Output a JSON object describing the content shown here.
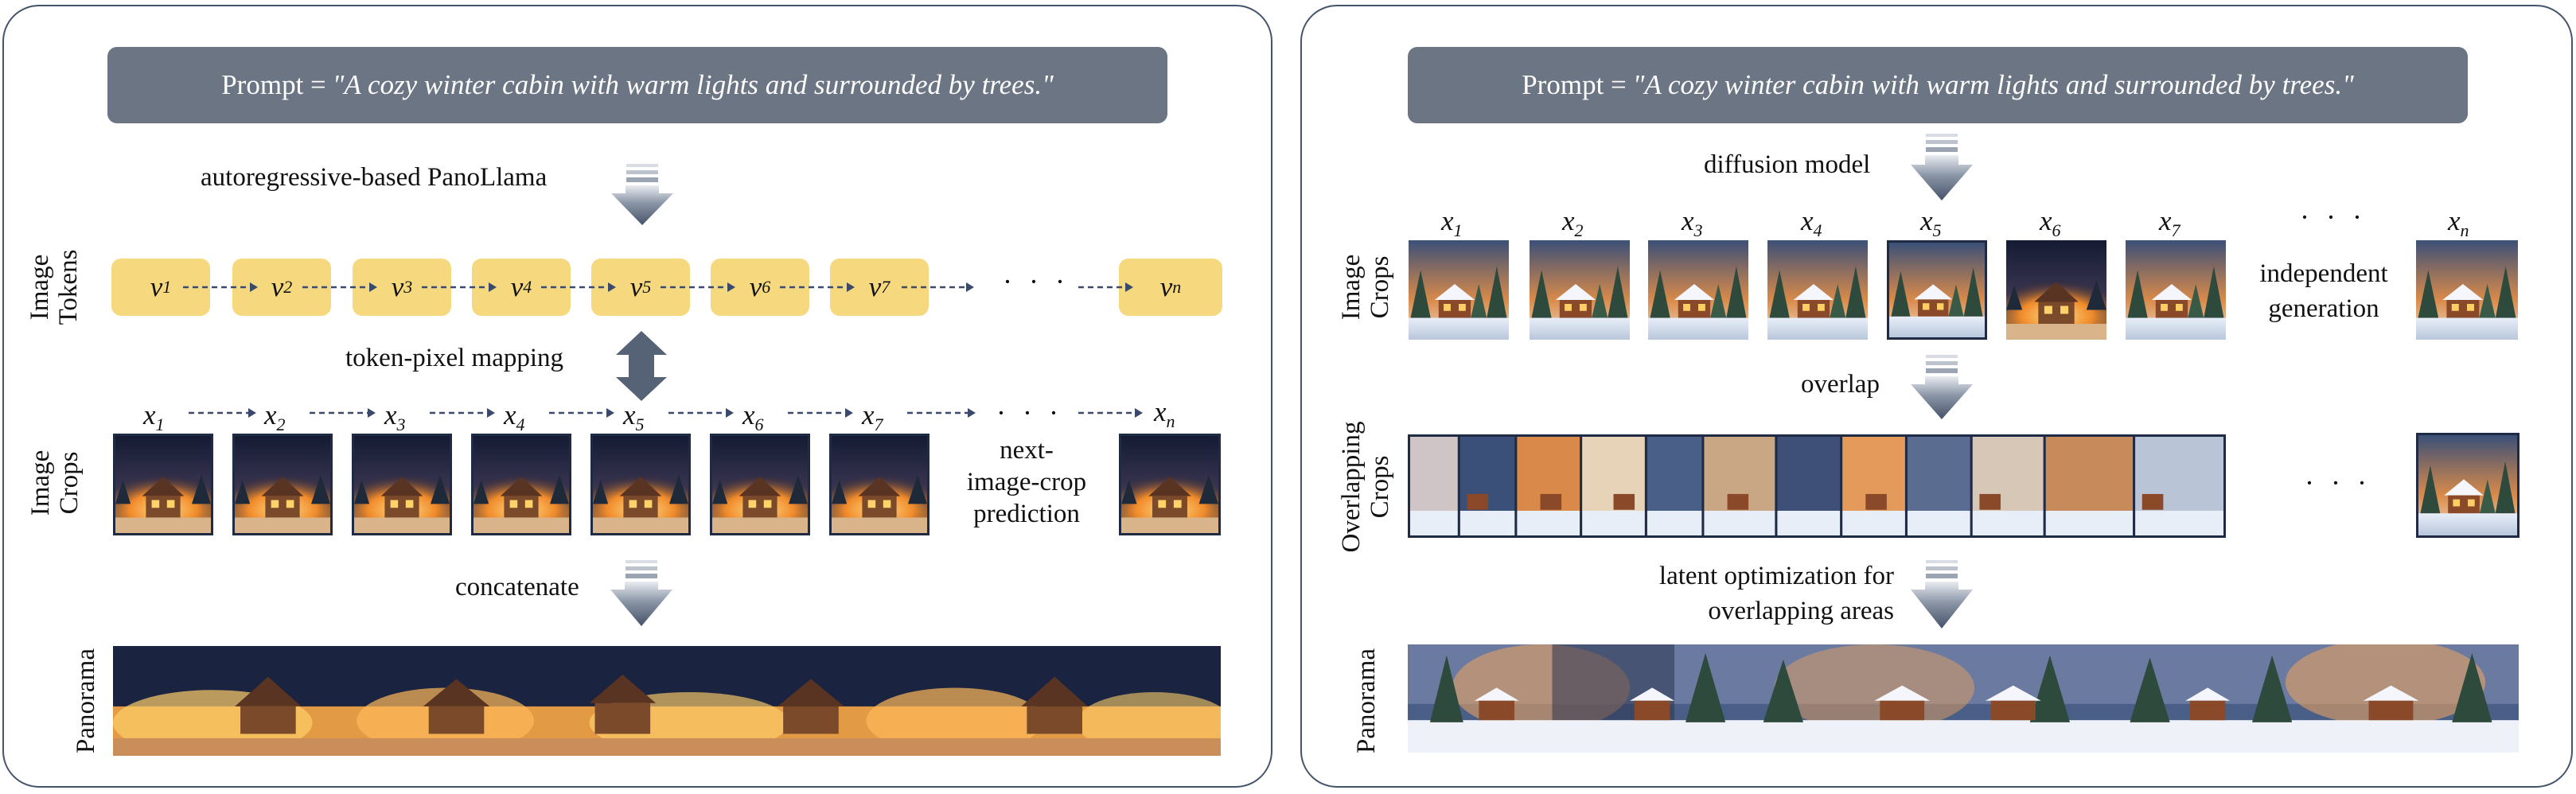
{
  "left": {
    "prompt_label": "Prompt = ",
    "prompt_text": "\"A cozy winter cabin with warm lights and surrounded by trees.\"",
    "step1": "autoregressive-based PanoLlama",
    "row_tokens_label_1": "Image",
    "row_tokens_label_2": "Tokens",
    "tokens": [
      "v",
      "v",
      "v",
      "v",
      "v",
      "v",
      "v",
      "v"
    ],
    "token_subs": [
      "1",
      "2",
      "3",
      "4",
      "5",
      "6",
      "7",
      "n"
    ],
    "step2": "token-pixel mapping",
    "row_crops_label_1": "Image",
    "row_crops_label_2": "Crops",
    "x_symbol": "x",
    "x_subs": [
      "1",
      "2",
      "3",
      "4",
      "5",
      "6",
      "7",
      "n"
    ],
    "ellipsis": "· · ·",
    "note_1": "next-",
    "note_2": "image-crop",
    "note_3": "prediction",
    "step3": "concatenate",
    "row_pano_label": "Panorama"
  },
  "right": {
    "prompt_label": "Prompt = ",
    "prompt_text": "\"A cozy winter cabin with warm lights and surrounded by trees.\"",
    "step1": "diffusion model",
    "row_crops_label_1": "Image",
    "row_crops_label_2": "Crops",
    "x_symbol": "x",
    "x_subs": [
      "1",
      "2",
      "3",
      "4",
      "5",
      "6",
      "7",
      "n"
    ],
    "ellipsis": "· · ·",
    "note_1": "independent",
    "note_2": "generation",
    "step2": "overlap",
    "row_overlap_label_1": "Overlapping",
    "row_overlap_label_2": "Crops",
    "step3_1": "latent optimization for",
    "step3_2": "overlapping areas",
    "row_pano_label": "Panorama"
  },
  "colors": {
    "border": "#44546a",
    "prompt_bg": "#6c7584",
    "token_bg": "#f6d97e",
    "arrow": "#566377",
    "warm_night": "#1a2340",
    "warm_glow": "#f2a23a"
  },
  "icons": {
    "down-arrow": "gradient-down-arrow-icon",
    "bidirectional-arrow": "double-arrow-icon",
    "dashed-arrow": "dashed-right-arrow-icon"
  }
}
